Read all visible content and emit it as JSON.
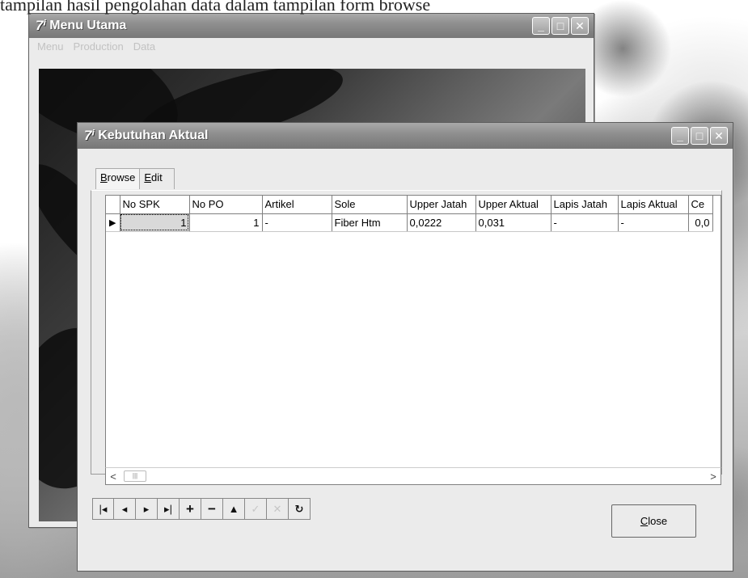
{
  "caption": "tampilan hasil pengolahan data dalam tampilan form browse",
  "main_window": {
    "title": "Menu Utama",
    "menu": [
      "Menu",
      "Production",
      "Data"
    ]
  },
  "child_window": {
    "title": "Kebutuhan Aktual",
    "tabs": [
      {
        "key": "B",
        "rest": "rowse"
      },
      {
        "key": "E",
        "rest": "dit"
      }
    ],
    "grid": {
      "columns": [
        "No SPK",
        "No PO",
        "Artikel",
        "Sole",
        "Upper Jatah",
        "Upper Aktual",
        "Lapis Jatah",
        "Lapis Aktual",
        "Ce"
      ],
      "rows": [
        [
          "1",
          "1",
          "-",
          "Fiber Htm",
          "0,0222",
          "0,031",
          "-",
          "-",
          "0,0"
        ]
      ]
    },
    "scroll_thumb": "|||",
    "navigator": {
      "buttons": [
        {
          "icon": "first-record-icon",
          "glyph": "|◂"
        },
        {
          "icon": "prior-record-icon",
          "glyph": "◂"
        },
        {
          "icon": "next-record-icon",
          "glyph": "▸"
        },
        {
          "icon": "last-record-icon",
          "glyph": "▸|"
        },
        {
          "icon": "insert-record-icon",
          "glyph": "+"
        },
        {
          "icon": "delete-record-icon",
          "glyph": "−"
        },
        {
          "icon": "edit-record-icon",
          "glyph": "▲"
        },
        {
          "icon": "post-edit-icon",
          "glyph": "✓"
        },
        {
          "icon": "cancel-edit-icon",
          "glyph": "✕"
        },
        {
          "icon": "refresh-data-icon",
          "glyph": "↻"
        }
      ]
    },
    "close_button": {
      "key": "C",
      "rest": "lose"
    }
  }
}
